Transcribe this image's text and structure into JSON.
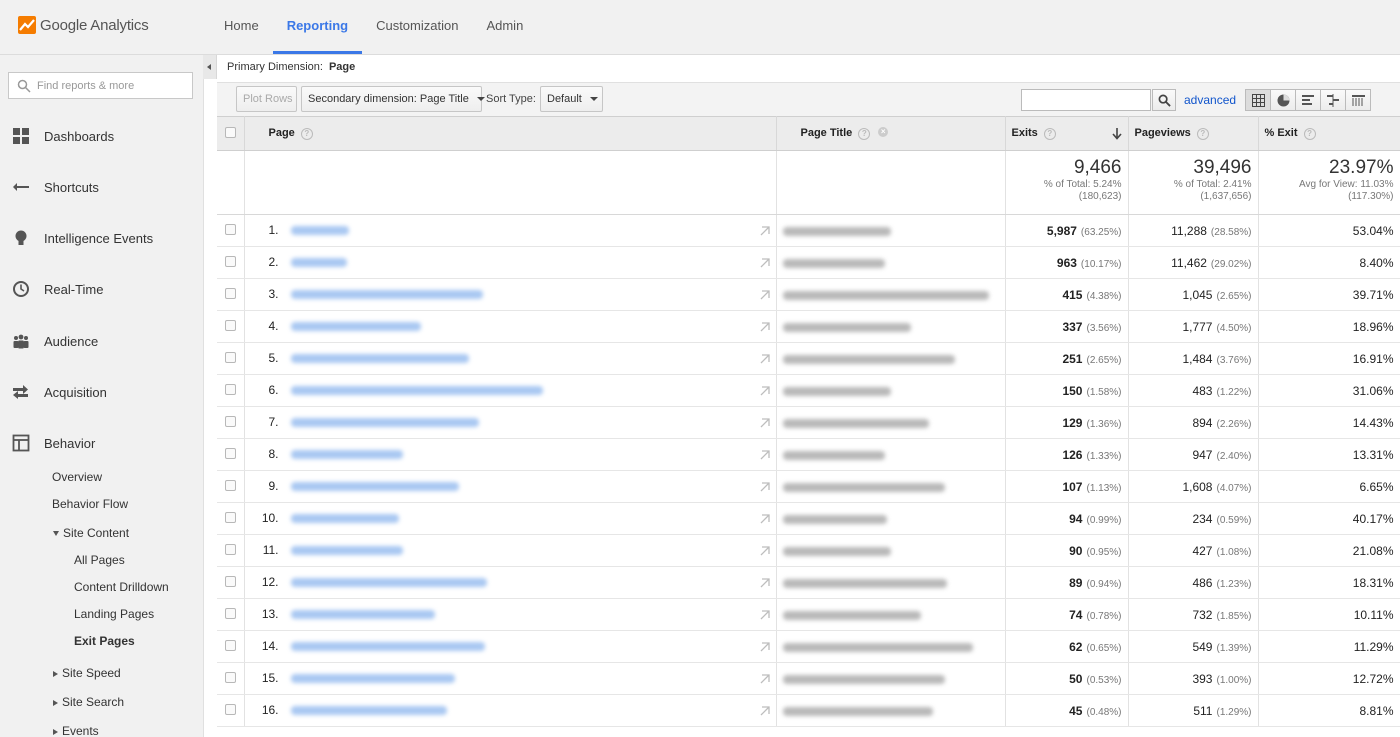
{
  "app": {
    "name": "Google Analytics",
    "brand_color": "#f57c00",
    "accent_color": "#3b78e7"
  },
  "nav": {
    "items": [
      {
        "label": "Home",
        "active": false
      },
      {
        "label": "Reporting",
        "active": true
      },
      {
        "label": "Customization",
        "active": false
      },
      {
        "label": "Admin",
        "active": false
      }
    ]
  },
  "sidebar": {
    "search_placeholder": "Find reports & more",
    "items": [
      {
        "label": "Dashboards",
        "icon": "dashboard-icon"
      },
      {
        "label": "Shortcuts",
        "icon": "shortcut-icon"
      },
      {
        "label": "Intelligence Events",
        "icon": "bulb-icon"
      },
      {
        "label": "Real-Time",
        "icon": "clock-icon"
      },
      {
        "label": "Audience",
        "icon": "people-icon"
      },
      {
        "label": "Acquisition",
        "icon": "acquisition-icon"
      },
      {
        "label": "Behavior",
        "icon": "behavior-icon"
      }
    ],
    "behavior": {
      "overview": "Overview",
      "flow": "Behavior Flow",
      "site_content": "Site Content",
      "all_pages": "All Pages",
      "content_drilldown": "Content Drilldown",
      "landing_pages": "Landing Pages",
      "exit_pages": "Exit Pages",
      "site_speed": "Site Speed",
      "site_search": "Site Search",
      "events": "Events"
    }
  },
  "report": {
    "primary_dimension_label": "Primary Dimension:",
    "primary_dimension_value": "Page",
    "toolbar": {
      "plot_rows": "Plot Rows",
      "secondary_dimension": "Secondary dimension: Page Title",
      "sort_type_label": "Sort Type:",
      "sort_type_value": "Default",
      "advanced": "advanced"
    },
    "columns": {
      "page": "Page",
      "page_title": "Page Title",
      "exits": "Exits",
      "pageviews": "Pageviews",
      "exit_rate": "% Exit"
    },
    "totals": {
      "exits": "9,466",
      "exits_sub1": "% of Total: 5.24%",
      "exits_sub2": "(180,623)",
      "pageviews": "39,496",
      "pageviews_sub1": "% of Total: 2.41%",
      "pageviews_sub2": "(1,637,656)",
      "exit_rate": "23.97%",
      "exit_rate_sub1": "Avg for View: 11.03%",
      "exit_rate_sub2": "(117.30%)"
    },
    "rows": [
      {
        "n": "1.",
        "exits": "5,987",
        "exits_pct": "(63.25%)",
        "pv": "11,288",
        "pv_pct": "(28.58%)",
        "exit": "53.04%"
      },
      {
        "n": "2.",
        "exits": "963",
        "exits_pct": "(10.17%)",
        "pv": "11,462",
        "pv_pct": "(29.02%)",
        "exit": "8.40%"
      },
      {
        "n": "3.",
        "exits": "415",
        "exits_pct": "(4.38%)",
        "pv": "1,045",
        "pv_pct": "(2.65%)",
        "exit": "39.71%"
      },
      {
        "n": "4.",
        "exits": "337",
        "exits_pct": "(3.56%)",
        "pv": "1,777",
        "pv_pct": "(4.50%)",
        "exit": "18.96%"
      },
      {
        "n": "5.",
        "exits": "251",
        "exits_pct": "(2.65%)",
        "pv": "1,484",
        "pv_pct": "(3.76%)",
        "exit": "16.91%"
      },
      {
        "n": "6.",
        "exits": "150",
        "exits_pct": "(1.58%)",
        "pv": "483",
        "pv_pct": "(1.22%)",
        "exit": "31.06%"
      },
      {
        "n": "7.",
        "exits": "129",
        "exits_pct": "(1.36%)",
        "pv": "894",
        "pv_pct": "(2.26%)",
        "exit": "14.43%"
      },
      {
        "n": "8.",
        "exits": "126",
        "exits_pct": "(1.33%)",
        "pv": "947",
        "pv_pct": "(2.40%)",
        "exit": "13.31%"
      },
      {
        "n": "9.",
        "exits": "107",
        "exits_pct": "(1.13%)",
        "pv": "1,608",
        "pv_pct": "(4.07%)",
        "exit": "6.65%"
      },
      {
        "n": "10.",
        "exits": "94",
        "exits_pct": "(0.99%)",
        "pv": "234",
        "pv_pct": "(0.59%)",
        "exit": "40.17%"
      },
      {
        "n": "11.",
        "exits": "90",
        "exits_pct": "(0.95%)",
        "pv": "427",
        "pv_pct": "(1.08%)",
        "exit": "21.08%"
      },
      {
        "n": "12.",
        "exits": "89",
        "exits_pct": "(0.94%)",
        "pv": "486",
        "pv_pct": "(1.23%)",
        "exit": "18.31%"
      },
      {
        "n": "13.",
        "exits": "74",
        "exits_pct": "(0.78%)",
        "pv": "732",
        "pv_pct": "(1.85%)",
        "exit": "10.11%"
      },
      {
        "n": "14.",
        "exits": "62",
        "exits_pct": "(0.65%)",
        "pv": "549",
        "pv_pct": "(1.39%)",
        "exit": "11.29%"
      },
      {
        "n": "15.",
        "exits": "50",
        "exits_pct": "(0.53%)",
        "pv": "393",
        "pv_pct": "(1.00%)",
        "exit": "12.72%"
      },
      {
        "n": "16.",
        "exits": "45",
        "exits_pct": "(0.48%)",
        "pv": "511",
        "pv_pct": "(1.29%)",
        "exit": "8.81%"
      }
    ]
  }
}
